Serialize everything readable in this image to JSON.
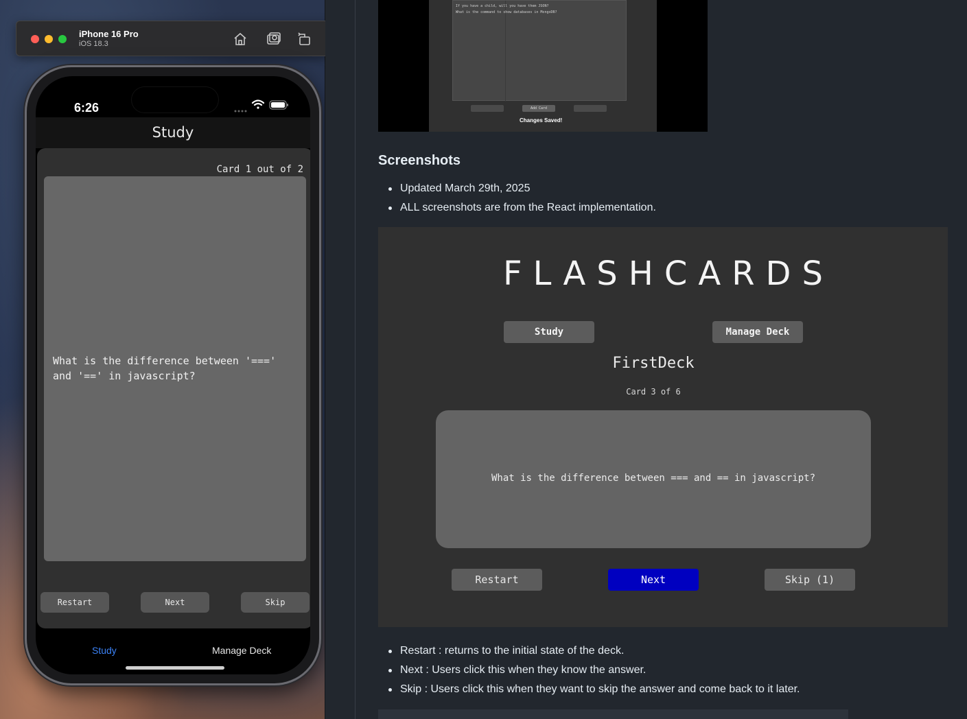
{
  "simulator": {
    "device_name": "iPhone 16 Pro",
    "os_version": "iOS 18.3",
    "toolbar_icons": [
      "home-icon",
      "screenshot-icon",
      "rotate-icon"
    ]
  },
  "phone": {
    "status_time": "6:26",
    "nav_title": "Study",
    "card_counter": "Card 1 out of 2",
    "card_text": "What is the difference between '===' and '==' in javascript?",
    "buttons": {
      "restart": "Restart",
      "next": "Next",
      "skip": "Skip"
    },
    "tabs": {
      "study": "Study",
      "manage": "Manage Deck"
    },
    "active_tab_color": "#3b82f6"
  },
  "doc": {
    "prev_image": {
      "line1": "If you have a child, will you have them JSON?",
      "line2": "What is the command to show databases in MongoDB?",
      "btn_add": "Add Card",
      "saved": "Changes Saved!"
    },
    "screenshots_heading": "Screenshots",
    "bullets_top": [
      "Updated March 29th, 2025",
      "ALL screenshots are from the React implementation."
    ],
    "react": {
      "title": "FLASHCARDS",
      "study_btn": "Study",
      "manage_btn": "Manage Deck",
      "deck_name": "FirstDeck",
      "counter": "Card 3 of 6",
      "card_text": "What is the difference between === and == in javascript?",
      "restart": "Restart",
      "next": "Next",
      "skip": "Skip (1)",
      "next_color": "#0000c0"
    },
    "bullets_bottom": [
      "Restart : returns to the initial state of the deck.",
      "Next : Users click this when they know the answer.",
      "Skip : Users click this when they want to skip the answer and come back to it later."
    ]
  }
}
